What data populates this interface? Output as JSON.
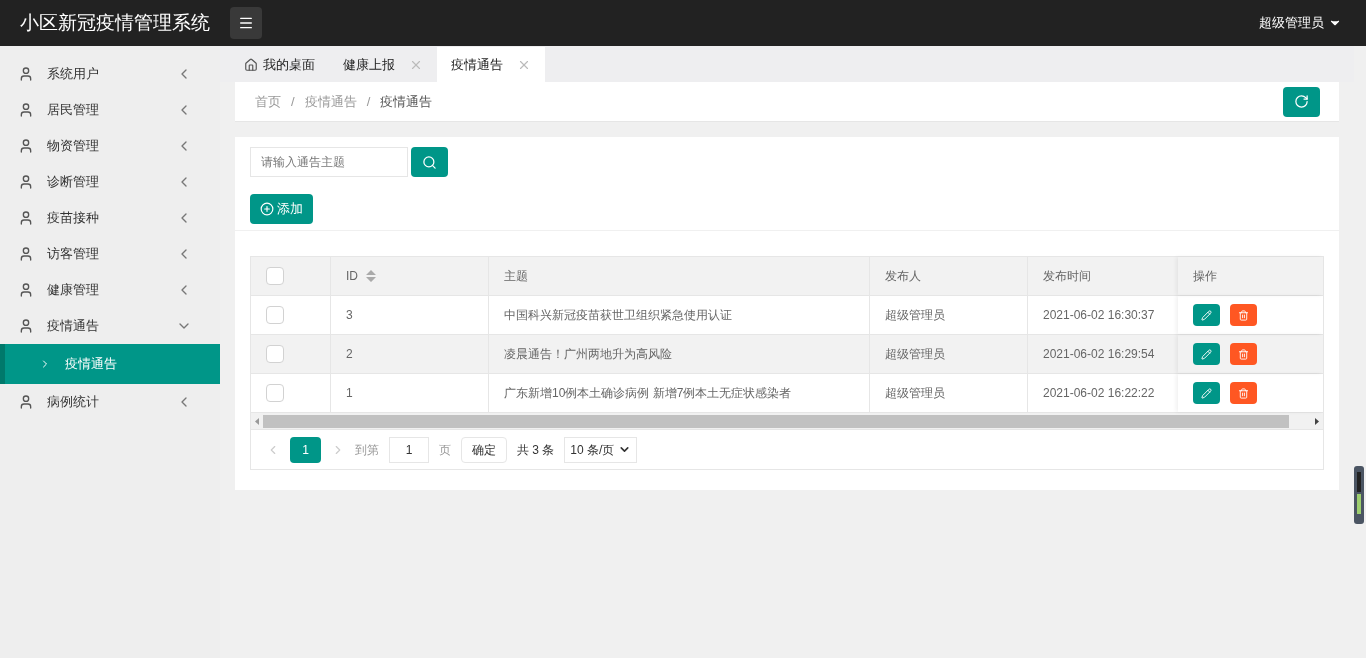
{
  "header": {
    "title": "小区新冠疫情管理系统",
    "user": "超级管理员"
  },
  "sidebar": {
    "items": [
      {
        "label": "系统用户",
        "expanded": false
      },
      {
        "label": "居民管理",
        "expanded": false
      },
      {
        "label": "物资管理",
        "expanded": false
      },
      {
        "label": "诊断管理",
        "expanded": false
      },
      {
        "label": "疫苗接种",
        "expanded": false
      },
      {
        "label": "访客管理",
        "expanded": false
      },
      {
        "label": "健康管理",
        "expanded": false
      },
      {
        "label": "疫情通告",
        "expanded": true,
        "children": [
          {
            "label": "疫情通告",
            "selected": true
          }
        ]
      },
      {
        "label": "病例统计",
        "expanded": false
      }
    ]
  },
  "tabs": [
    {
      "kind": "home",
      "label": "我的桌面",
      "selected": false,
      "closable": false
    },
    {
      "kind": "page",
      "label": "健康上报",
      "selected": false,
      "closable": true
    },
    {
      "kind": "page",
      "label": "疫情通告",
      "selected": true,
      "closable": true
    }
  ],
  "breadcrumb_separator": "/",
  "breadcrumb": [
    {
      "label": "首页",
      "current": false
    },
    {
      "label": "疫情通告",
      "current": false
    },
    {
      "label": "疫情通告",
      "current": true
    }
  ],
  "search": {
    "placeholder": "请输入通告主题"
  },
  "add_button": "添加",
  "table": {
    "header_checked": false,
    "columns": [
      "ID",
      "主题",
      "发布人",
      "发布时间",
      "操作"
    ],
    "rows": [
      {
        "checked": false,
        "highlighted": false,
        "cells": [
          "3",
          "中国科兴新冠疫苗获世卫组织紧急使用认证",
          "超级管理员",
          "2021-06-02 16:30:37"
        ]
      },
      {
        "checked": false,
        "highlighted": true,
        "cells": [
          "2",
          "凌晨通告！广州两地升为高风险",
          "超级管理员",
          "2021-06-02 16:29:54"
        ]
      },
      {
        "checked": false,
        "highlighted": false,
        "cells": [
          "1",
          "广东新增10例本土确诊病例 新增7例本土无症状感染者",
          "超级管理员",
          "2021-06-02 16:22:22"
        ]
      }
    ]
  },
  "pagination": {
    "current_page": "1",
    "goto_label": "到第",
    "goto_value": "1",
    "page_label": "页",
    "confirm": "确定",
    "total": "共 3 条",
    "page_size": "10 条/页"
  }
}
